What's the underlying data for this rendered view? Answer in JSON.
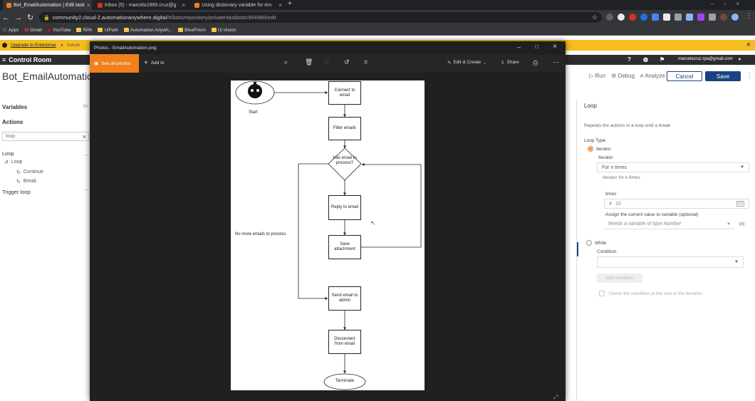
{
  "browser": {
    "tabs": [
      {
        "title": "Bot_EmailAutomation | Edit task",
        "color": "#f47b20"
      },
      {
        "title": "Inbox (5) - marcelo1999.cruz@g",
        "color": "#d93025"
      },
      {
        "title": "Using dictionary variable for em",
        "color": "#f47b20"
      }
    ],
    "url_host": "community2.cloud-2.automationanywhere.digital",
    "url_path": "/#/bots/repository/private/taskbots/654960/edit",
    "bookmarks": [
      "Apps",
      "Gmail",
      "YouTube",
      "RPA",
      "UiPath",
      "Automation Anywh...",
      "BluePrism",
      "Ui.Vision"
    ]
  },
  "app": {
    "upgrade_link": "Upgrade to Enterprise",
    "advanced_text": "Advan",
    "control_room": "Control Room",
    "user_email": "marcelocruz.rpa@gmail.com",
    "bot_name": "Bot_EmailAutomatic",
    "run_label": "Run",
    "debug_label": "Debug",
    "analyze_label": "Analyze",
    "cancel_label": "Cancel",
    "save_label": "Save",
    "sidebar": {
      "variables_label": "Variables",
      "show_label": "Sh",
      "actions_label": "Actions",
      "search_value": "loop",
      "loop_group": "Loop",
      "loop_item": "Loop",
      "continue_item": "Continue",
      "break_item": "Break",
      "trigger_loop": "Trigger loop"
    },
    "right": {
      "title": "Loop",
      "description": "Repeats the actions in a loop until a break",
      "loop_type_label": "Loop Type",
      "iterator_option": "Iterator",
      "iterator_label": "Iterator",
      "iterator_value": "For n times",
      "iterator_desc": "Iterator for n times",
      "times_label": "times",
      "times_value": "10",
      "assign_label": "Assign the current value to variable (optional)",
      "assign_placeholder": "Needs a variable of type Number",
      "while_option": "While",
      "condition_label": "Condition",
      "add_condition": "Add condition",
      "check_condition": "Check the condition at the end of the iteration"
    }
  },
  "photos": {
    "window_title": "Photos - EmailAutomation.png",
    "see_all": "See all photos",
    "add_to": "Add to",
    "edit_create": "Edit & Create",
    "share": "Share",
    "flowchart": {
      "start_label": "Start",
      "connect": "Connect to email",
      "filter": "Filter emails",
      "decision": "Has email to process?",
      "reply": "Reply to email",
      "save": "Save attachment",
      "send_admin": "Send email to admin",
      "disconnect": "Disconnect from email",
      "terminate": "Terminate",
      "no_more": "No more emails to process"
    }
  }
}
